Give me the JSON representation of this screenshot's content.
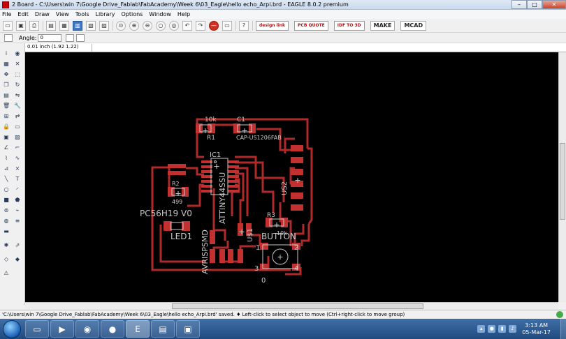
{
  "window": {
    "title": "2 Board - C:\\Users\\win 7\\Google Drive_Fablab\\FabAcademy\\Week 6\\03_Eagle\\hello echo_Arpi.brd - EAGLE 8.0.2 premium",
    "minimize": "–",
    "maximize": "□",
    "close": "✕"
  },
  "menu": [
    "File",
    "Edit",
    "Draw",
    "View",
    "Tools",
    "Library",
    "Options",
    "Window",
    "Help"
  ],
  "toolbar": {
    "brands": {
      "design_link": "design link",
      "pcb_quote": "PCB QUOTE",
      "idf": "IDF TO 3D",
      "make": "MAKE",
      "mcad": "MCAD"
    }
  },
  "params": {
    "angle_label": "Angle:",
    "angle_value": "0"
  },
  "coord": "0.01 inch (1.92 1.22)",
  "board": {
    "labels": {
      "r1_value": "10k",
      "r1": "R1",
      "c1": "C1",
      "c1_pkg": "CAP-US1206FAB",
      "ic1": "IC1",
      "ic1_pkg": "ATTINY44SSU",
      "r2": "R2",
      "r2_value": "499",
      "us2": "US2",
      "pc": "PC56H19 V0",
      "led1": "LED1",
      "avr": "AVRISPSMD",
      "us1": "U$1",
      "r3": "R3",
      "r3_value": "10k",
      "button": "BUTTON",
      "p1": "1",
      "p2": "2",
      "p3": "3",
      "p4": "4",
      "zero": "0"
    }
  },
  "status": "'C:\\Users\\win 7\\Google Drive_Fablab\\FabAcademy\\Week 6\\03_Eagle\\hello echo_Arpi.brd' saved.  ♦ Left-click to select object to move (Ctrl+right-click to move group)",
  "taskbar": {
    "time": "3:13 AM",
    "date": "05-Mar-17"
  },
  "colors": {
    "canvas": "#000000",
    "copper": "#b02a2a",
    "pad": "#c23030",
    "silk": "#c8c8c8"
  }
}
